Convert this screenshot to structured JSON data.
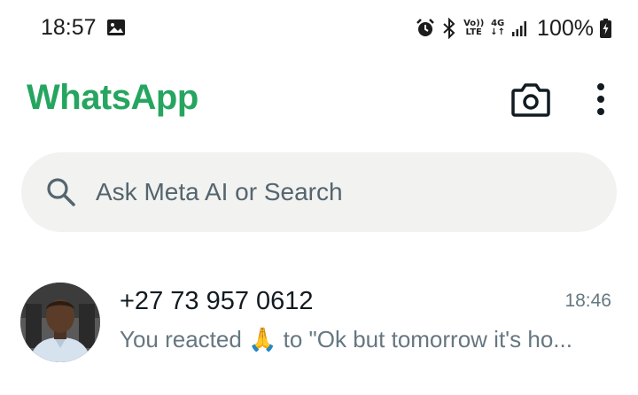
{
  "status_bar": {
    "time": "18:57",
    "network_top": "Vo))",
    "network_bottom": "LTE",
    "network_type": "4G",
    "battery": "100%",
    "icons": [
      "gallery-icon",
      "alarm-icon",
      "bluetooth-icon",
      "signal-icon",
      "battery-charging-icon"
    ]
  },
  "header": {
    "title": "WhatsApp",
    "brand_color": "#25a55f",
    "icons": [
      "camera-icon",
      "more-vert-icon"
    ]
  },
  "search": {
    "placeholder": "Ask Meta AI or Search"
  },
  "chats": [
    {
      "name": "+27 73 957 0612",
      "time": "18:46",
      "preview": "You reacted 🙏 to \"Ok but tomorrow it's ho..."
    }
  ]
}
